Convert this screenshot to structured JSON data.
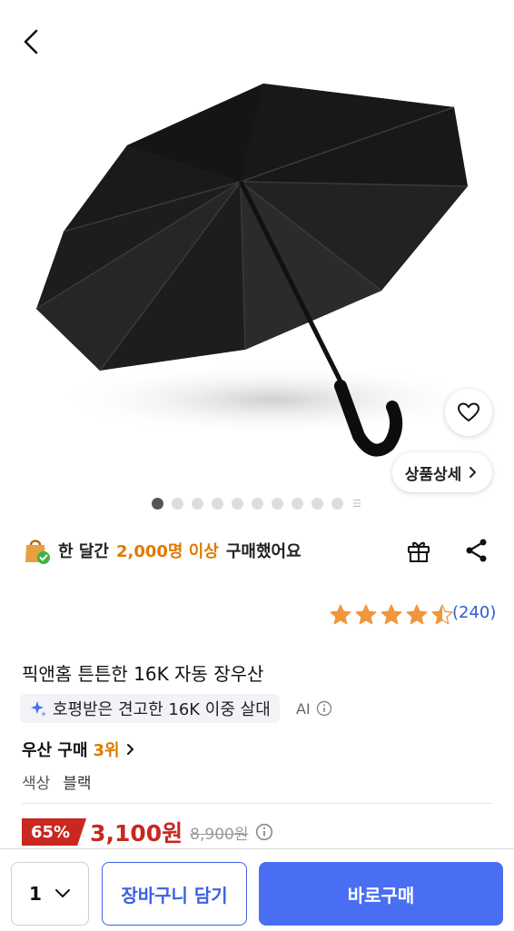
{
  "product": {
    "title": "픽앤홈 튼튼한 16K 자동 장우산",
    "detail_button_label": "상품상세",
    "image_dot_count": 10,
    "active_image_index": 0
  },
  "buyers": {
    "prefix": "한 달간",
    "highlight": "2,000명 이상",
    "suffix": "구매했어요"
  },
  "rating": {
    "stars": 4.5,
    "count": "(240)"
  },
  "ai_summary": {
    "text": "호평받은 견고한 16K 이중 살대",
    "tag": "AI"
  },
  "ranking": {
    "category": "우산 구매",
    "rank": "3위"
  },
  "option": {
    "label": "색상",
    "value": "블랙"
  },
  "price": {
    "discount": "65%",
    "sale": "3,100원",
    "original": "8,900원"
  },
  "bottom_bar": {
    "quantity": "1",
    "cart_label": "장바구니 담기",
    "buy_label": "바로구매"
  },
  "colors": {
    "accent": "#e07a00",
    "price_red": "#c8281e",
    "primary_blue": "#4a6ef2",
    "link_blue": "#2f5bd6",
    "star": "#f0963c"
  },
  "icons": [
    "back-icon",
    "heart-icon",
    "chevron-right-icon",
    "shopping-bag-icon",
    "gift-icon",
    "share-icon",
    "star-icon",
    "sparkle-icon",
    "info-icon",
    "chevron-down-icon"
  ]
}
